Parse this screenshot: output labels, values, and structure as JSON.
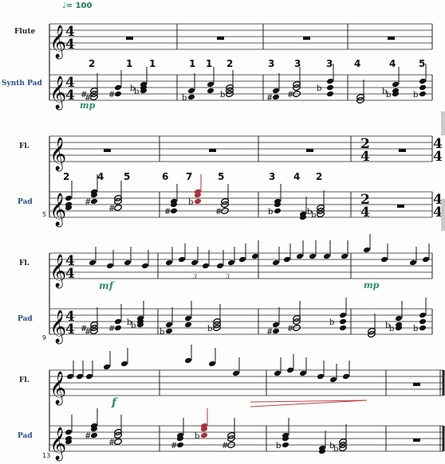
{
  "tempo": "♩= 100",
  "instruments": {
    "flute_full": "Flute",
    "pad_full": "Synth Pad",
    "flute_short": "Fl.",
    "pad_short": "Pad"
  },
  "measure_numbers": [
    "5",
    "9",
    "13"
  ],
  "dynamics": {
    "sys1_pad": "mp",
    "sys3_flute_a": "mf",
    "sys3_flute_b": "mp",
    "sys4_flute": "f"
  },
  "triplets": [
    "3",
    "3"
  ],
  "fingerings": {
    "sys1": [
      "2",
      "1",
      "1",
      "1",
      "1",
      "2",
      "3",
      "3",
      "3",
      "4",
      "4",
      "5"
    ],
    "sys2": [
      "2",
      "4",
      "5",
      "6",
      "7",
      "5",
      "3",
      "4",
      "2"
    ]
  },
  "colors": {
    "staff": "#222222",
    "label": "#2b4f86",
    "dynamic": "#2a8a70",
    "highlight": "#b0303c",
    "hairpin": "#c0404a"
  }
}
